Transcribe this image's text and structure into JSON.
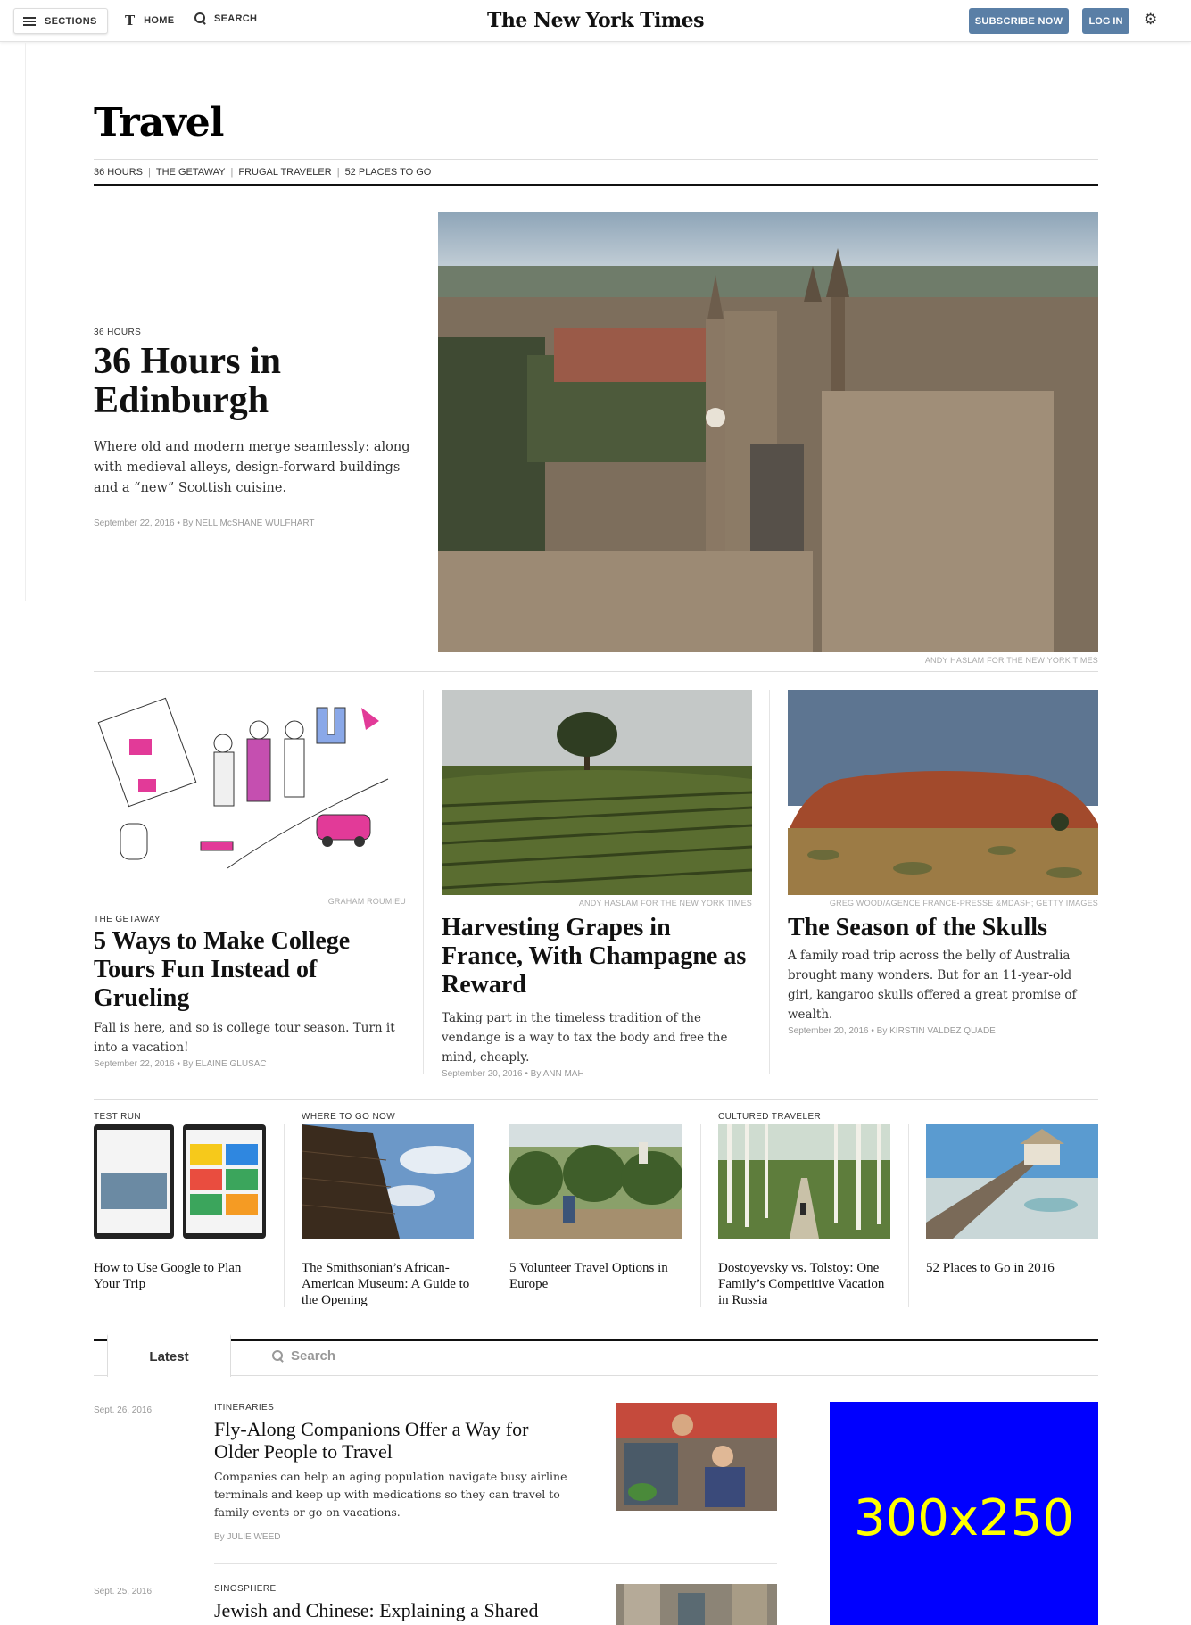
{
  "masthead": {
    "sections_label": "SECTIONS",
    "home_label": "HOME",
    "home_glyph": "T",
    "search_label": "SEARCH",
    "logo": "The New York Times",
    "subscribe_label": "SUBSCRIBE NOW",
    "login_label": "LOG IN",
    "settings_glyph": "⚙"
  },
  "section": {
    "title": "Travel",
    "subnav": [
      "36 HOURS",
      "THE GETAWAY",
      "FRUGAL TRAVELER",
      "52 PLACES TO GO"
    ],
    "subnav_sep": "|"
  },
  "lead": {
    "kicker": "36 HOURS",
    "title": "36 Hours in Edinburgh",
    "summary": "Where old and modern merge seamlessly: along with medieval alleys, design-forward buildings and a “new” Scottish cuisine.",
    "byline": "September 22, 2016 • By NELL McSHANE WULFHART",
    "credit": "ANDY HASLAM FOR THE NEW YORK TIMES"
  },
  "stories": [
    {
      "kicker": "THE GETAWAY",
      "title": "5 Ways to Make College Tours Fun Instead of Grueling",
      "summary": "Fall is here, and so is college tour season. Turn it into a vacation!",
      "byline": "September 22, 2016 • By ELAINE GLUSAC",
      "credit": "GRAHAM ROUMIEU"
    },
    {
      "kicker": "",
      "title": "Harvesting Grapes in France, With Champagne as Reward",
      "summary": "Taking part in the timeless tradition of the vendange is a way to tax the body and free the mind, cheaply.",
      "byline": "September 20, 2016 • By ANN MAH",
      "credit": "ANDY HASLAM FOR THE NEW YORK TIMES"
    },
    {
      "kicker": "",
      "title": "The Season of the Skulls",
      "summary": "A family road trip across the belly of Australia brought many wonders. But for an 11-year-old girl, kangaroo skulls offered a great promise of wealth.",
      "byline": "September 20, 2016 • By KIRSTIN VALDEZ QUADE",
      "credit": "GREG WOOD/AGENCE FRANCE-PRESSE &MDASH; GETTY IMAGES"
    }
  ],
  "minis": [
    {
      "kicker": "TEST RUN",
      "title": "How to Use Google to Plan Your Trip"
    },
    {
      "kicker": "WHERE TO GO NOW",
      "title": "The Smithsonian’s African-American Museum: A Guide to the Opening"
    },
    {
      "kicker": "",
      "title": "5 Volunteer Travel Options in Europe"
    },
    {
      "kicker": "CULTURED TRAVELER",
      "title": "Dostoyevsky vs. Tolstoy: One Family’s Competitive Vacation in Russia"
    },
    {
      "kicker": "",
      "title": "52 Places to Go in 2016"
    }
  ],
  "tabs": {
    "latest": "Latest",
    "search": "Search"
  },
  "latest": [
    {
      "date": "Sept. 26, 2016",
      "kicker": "ITINERARIES",
      "title": "Fly-Along Companions Offer a Way for Older People to Travel",
      "summary": "Companies can help an aging population navigate busy airline terminals and keep up with medications so they can travel to family events or go on vacations.",
      "byline": "By JULIE WEED"
    },
    {
      "date": "Sept. 25, 2016",
      "kicker": "SINOSPHERE",
      "title": "Jewish and Chinese: Explaining a Shared Menu"
    }
  ],
  "ad": {
    "label": "300x250"
  }
}
